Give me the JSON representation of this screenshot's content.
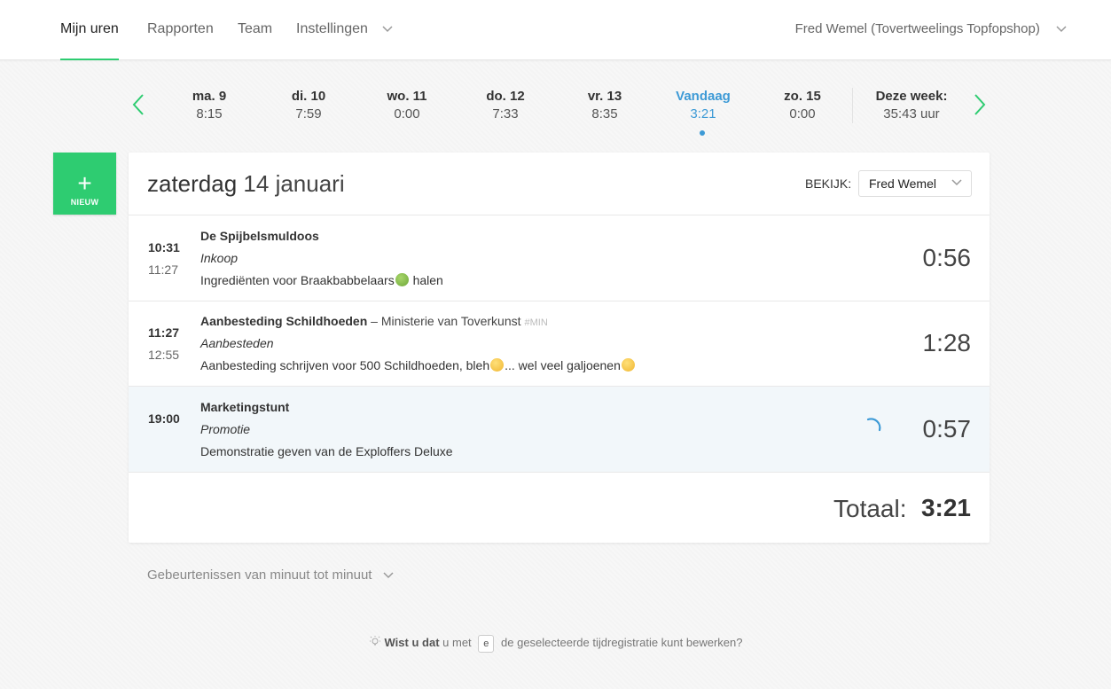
{
  "nav": {
    "items": [
      {
        "label": "Mijn uren",
        "active": true
      },
      {
        "label": "Rapporten",
        "active": false
      },
      {
        "label": "Team",
        "active": false
      },
      {
        "label": "Instellingen",
        "active": false
      }
    ],
    "user": "Fred Wemel (Tovertweelings Topfopshop)"
  },
  "week": {
    "days": [
      {
        "name": "ma. 9",
        "hours": "8:15"
      },
      {
        "name": "di. 10",
        "hours": "7:59"
      },
      {
        "name": "wo. 11",
        "hours": "0:00"
      },
      {
        "name": "do. 12",
        "hours": "7:33"
      },
      {
        "name": "vr. 13",
        "hours": "8:35"
      },
      {
        "name": "Vandaag",
        "hours": "3:21"
      },
      {
        "name": "zo. 15",
        "hours": "0:00"
      }
    ],
    "total_label": "Deze week:",
    "total_hours": "35:43 uur"
  },
  "new_button": {
    "label": "NIEUW"
  },
  "day": {
    "weekday": "zaterdag",
    "date": "14 januari",
    "view_label": "BEKIJK:",
    "view_selected": "Fred Wemel"
  },
  "entries": [
    {
      "start": "10:31",
      "end": "11:27",
      "project": "De Spijbelsmuldoos",
      "client": "",
      "tag": "",
      "task": "Inkoop",
      "desc_before": "Ingrediënten voor Braakbabbelaars",
      "desc_after": " halen",
      "duration": "0:56"
    },
    {
      "start": "11:27",
      "end": "12:55",
      "project": "Aanbesteding Schildhoeden",
      "client": " – Ministerie van Toverkunst",
      "tag": "#MIN",
      "task": "Aanbesteden",
      "desc_before": "Aanbesteding schrijven voor 500 Schildhoeden, bleh",
      "desc_mid": "... wel veel galjoenen",
      "desc_after": "",
      "duration": "1:28"
    },
    {
      "start": "19:00",
      "end": "",
      "project": "Marketingstunt",
      "client": "",
      "tag": "",
      "task": "Promotie",
      "desc_before": "Demonstratie geven van de Exploffers Deluxe",
      "desc_after": "",
      "duration": "0:57"
    }
  ],
  "total": {
    "label": "Totaal:",
    "value": "3:21"
  },
  "events_toggle": "Gebeurtenissen van minuut tot minuut",
  "tip": {
    "bold": "Wist u dat",
    "before": " u met ",
    "key": "e",
    "after": " de geselecteerde tijdregistratie kunt bewerken?"
  },
  "colors": {
    "accent_green": "#2ecc71",
    "today_blue": "#3d9ad6"
  }
}
